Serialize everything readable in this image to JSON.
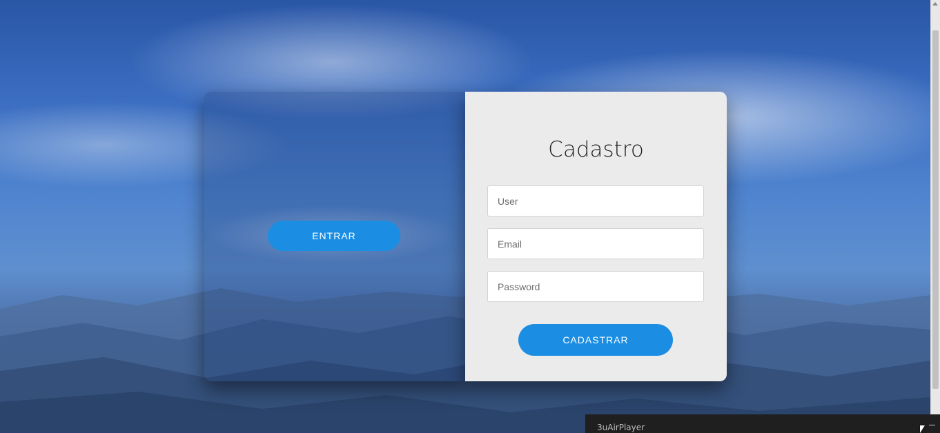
{
  "login_panel": {
    "entrar_label": "ENTRAR"
  },
  "signup_form": {
    "title": "Cadastro",
    "user_placeholder": "User",
    "email_placeholder": "Email",
    "password_placeholder": "Password",
    "submit_label": "CADASTRAR"
  },
  "taskbar": {
    "app_title": "3uAirPlayer"
  },
  "colors": {
    "button_blue": "#1b8ee3",
    "form_background": "#ebebeb",
    "sky_blue": "#3a6cc0"
  },
  "icons": {
    "cursor": "arrow-cursor-icon",
    "minimize": "minimize-icon"
  }
}
